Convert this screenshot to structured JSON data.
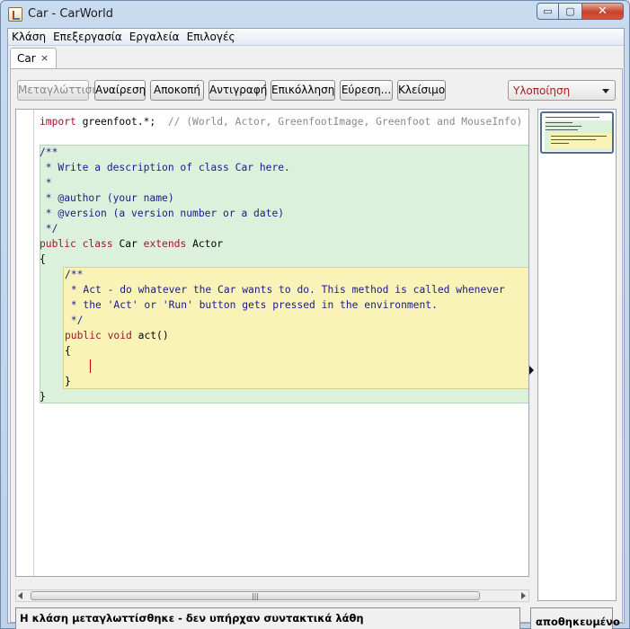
{
  "window": {
    "title": "Car - CarWorld",
    "controls": {
      "minimize": "▭",
      "maximize": "▢",
      "close": "✕"
    }
  },
  "menu": [
    "Κλάση",
    "Επεξεργασία",
    "Εργαλεία",
    "Επιλογές"
  ],
  "tab": {
    "label": "Car",
    "close": "×"
  },
  "toolbar": {
    "buttons": [
      "Μεταγλώττιση",
      "Αναίρεση",
      "Αποκοπή",
      "Αντιγραφή",
      "Επικόλληση",
      "Εύρεση...",
      "Κλείσιμο"
    ],
    "compile_disabled": true,
    "view_select": "Υλοποίηση"
  },
  "code": {
    "l1_kw": "import",
    "l1_text": " greenfoot.*;  ",
    "l1_comment": "// (World, Actor, GreenfootImage, Greenfoot and MouseInfo)",
    "l2": "/**",
    "l3": " * Write a description of class Car here.",
    "l4": " *",
    "l5": " * @author (your name)",
    "l6": " * @version (a version number or a date)",
    "l7": " */",
    "l8_kw1": "public",
    "l8_kw2": "class",
    "l8_name": " Car ",
    "l8_kw3": "extends",
    "l8_tail": " Actor",
    "l9": "{",
    "l10": "/**",
    "l11": " * Act - do whatever the Car wants to do. This method is called whenever",
    "l12": " * the 'Act' or 'Run' button gets pressed in the environment.",
    "l13": " */",
    "l14_kw1": "public",
    "l14_kw2": "void",
    "l14_name": " act()",
    "l15": "{",
    "l16": "}",
    "l17": "}"
  },
  "status": {
    "message": "Η κλάση μεταγλωττίσθηκε - δεν υπήρχαν συντακτικά λάθη",
    "saved": "αποθηκευμένο"
  },
  "colors": {
    "class_scope": "#dcf1dc",
    "method_scope": "#f9f3b8",
    "keyword": "#a0152a",
    "comment": "#1a1a8a"
  }
}
